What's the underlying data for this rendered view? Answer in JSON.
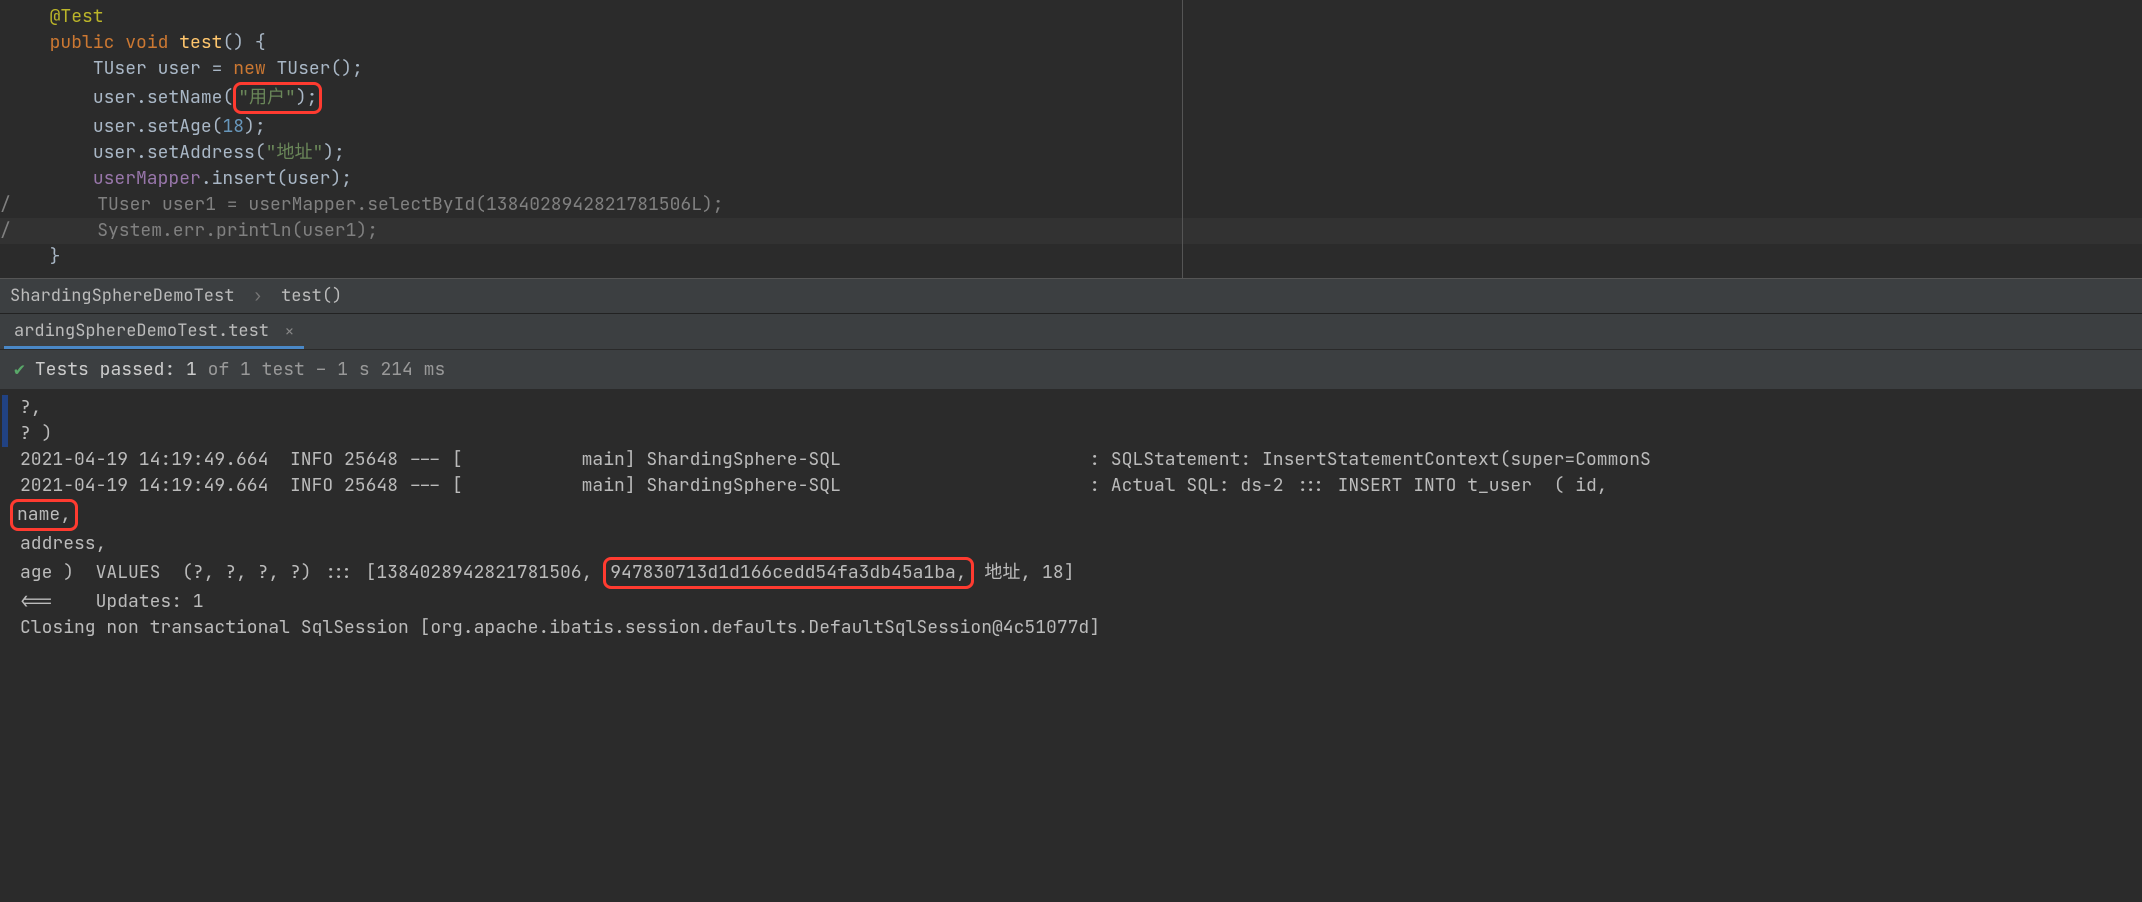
{
  "code": {
    "annotation": "@Test",
    "line2": {
      "kw1": "public",
      "kw2": "void",
      "method": "test",
      "paren": "() {"
    },
    "line3": {
      "type": "TUser",
      "var": "user",
      "eq": "=",
      "kwnew": "new",
      "ctor": "TUser",
      "tail": "();"
    },
    "line4": {
      "var": "user",
      "dot": ".",
      "method": "setName",
      "open": "(",
      "str": "\"用户\"",
      "close": ");"
    },
    "line5": {
      "var": "user",
      "method": "setAge",
      "open": "(",
      "num": "18",
      "close": ");"
    },
    "line6": {
      "var": "user",
      "method": "setAddress",
      "open": "(",
      "str": "\"地址\"",
      "close": ");"
    },
    "line7": {
      "field": "userMapper",
      "method": "insert",
      "open": "(",
      "arg": "user",
      "close": ");"
    },
    "line8": "/        TUser user1 = userMapper.selectById(1384028942821781506L);",
    "line9": "/        System.err.println(user1);",
    "closebrace": "}"
  },
  "breadcrumb": {
    "item1": "ShardingSphereDemoTest",
    "item2": "test()"
  },
  "tab": {
    "label": "ardingSphereDemoTest.test"
  },
  "status": {
    "label": "Tests passed",
    "count": ": 1",
    "rest": " of 1 test – 1 s 214 ms"
  },
  "console": {
    "l1": "?,",
    "l2": "? )",
    "l3": "2021-04-19 14:19:49.664  INFO 25648 --- [           main] ShardingSphere-SQL                       : SQLStatement: InsertStatementContext(super=CommonS",
    "l4a": "2021-04-19 14:19:49.664  INFO 25648 --- [           main] ShardingSphere-SQL                       : Actual SQL: ds-2 ::: INSERT INTO t_user  ( id,",
    "l5": "name,",
    "l6": "address,",
    "l7a": "age )  VALUES  (?, ?, ?, ?) ::: [1384028942821781506,",
    "l7b": "947830713d1d166cedd54fa3db45a1ba,",
    "l7c": " 地址, 18]",
    "l8": "<==    Updates: 1",
    "l9": "Closing non transactional SqlSession [org.apache.ibatis.session.defaults.DefaultSqlSession@4c51077d]"
  }
}
